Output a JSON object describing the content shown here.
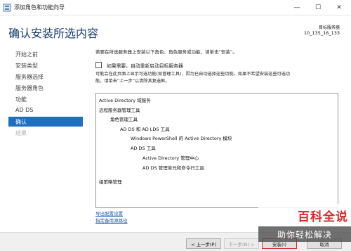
{
  "window": {
    "title": "添加角色和功能向导",
    "minimize": "—",
    "maximize": "☐",
    "close": "✕"
  },
  "header": {
    "title": "确认安装所选内容",
    "server_label": "目标服务器",
    "server_name": "10_135_16_133"
  },
  "nav": {
    "items": [
      {
        "label": "开始之前",
        "state": "normal"
      },
      {
        "label": "安装类型",
        "state": "normal"
      },
      {
        "label": "服务器选择",
        "state": "normal"
      },
      {
        "label": "服务器角色",
        "state": "normal"
      },
      {
        "label": "功能",
        "state": "normal"
      },
      {
        "label": "AD DS",
        "state": "normal"
      },
      {
        "label": "确认",
        "state": "active"
      },
      {
        "label": "结果",
        "state": "disabled"
      }
    ]
  },
  "content": {
    "intro": "若要在所选服务器上安装以下角色、角色服务或功能，请单击“安装”。",
    "restart_checkbox": "如果需要，自动重新启动目标服务器",
    "note_line1": "可能会在此页面上显示可选功能(如管理工具)，因为已自动选择这些功能。如果不希望安装这些可选功",
    "note_line2": "能，请单击“上一步”以清除其复选框。",
    "features": [
      "Active Directory 域服务",
      "远程服务器管理工具",
      "角色管理工具",
      "AD DS 和 AD LDS 工具",
      "Windows PowerShell 的 Active Directory 模块",
      "AD DS 工具",
      "Active Directory 管理中心",
      "AD DS 管理单元和命令行工具",
      "组策略管理"
    ],
    "export_link": "导出配置设置",
    "alt_source_link": "指定备用源路径"
  },
  "footer": {
    "prev": "< 上一步(P)",
    "next": "下一步(N) >",
    "install": "安装(I)",
    "cancel": "取消"
  },
  "watermark": {
    "top": "百科全说",
    "bottom": "助你轻松解决"
  },
  "colors": {
    "accent": "#1f6fbf",
    "title": "#1c3f6e",
    "link": "#1a5aa8"
  }
}
